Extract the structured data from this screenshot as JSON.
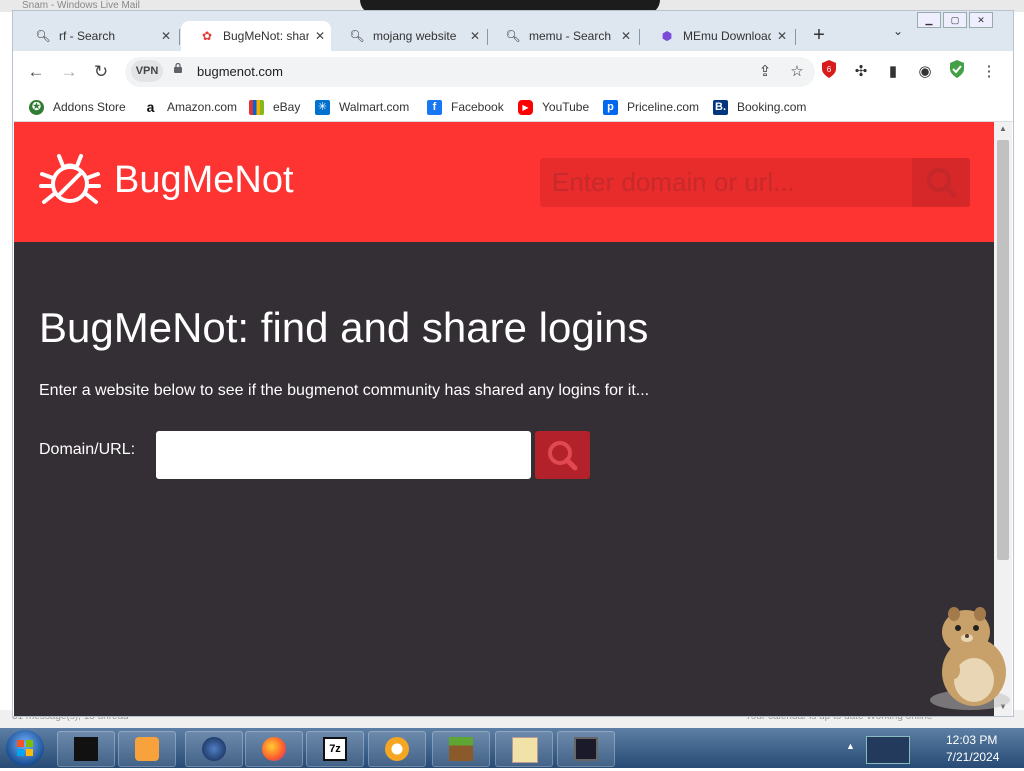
{
  "background": {
    "top_window_title": "Snam - Windows Live Mail",
    "bottom_left_status": "31 message(s), 15 unread",
    "bottom_right_status": "Your calendar is up to date   Working online"
  },
  "tabs": [
    {
      "label": "rf - Search",
      "icon": "search-icon",
      "active": false
    },
    {
      "label": "BugMeNot: share logins",
      "icon": "bug-icon",
      "active": true
    },
    {
      "label": "mojang website",
      "icon": "search-icon",
      "active": false
    },
    {
      "label": "memu - Search",
      "icon": "search-icon",
      "active": false
    },
    {
      "label": "MEmu Download",
      "icon": "memu-icon",
      "active": false
    }
  ],
  "toolbar": {
    "vpn_label": "VPN",
    "url": "bugmenot.com"
  },
  "bookmarks": [
    {
      "label": "Addons Store",
      "icon": "addons-icon",
      "color": "#2e7d32"
    },
    {
      "label": "Amazon.com",
      "icon": "amazon-icon",
      "color": "#111111"
    },
    {
      "label": "eBay",
      "icon": "ebay-icon",
      "color": "#e53238"
    },
    {
      "label": "Walmart.com",
      "icon": "walmart-icon",
      "color": "#0071ce"
    },
    {
      "label": "Facebook",
      "icon": "facebook-icon",
      "color": "#1877f2"
    },
    {
      "label": "YouTube",
      "icon": "youtube-icon",
      "color": "#ff0000"
    },
    {
      "label": "Priceline.com",
      "icon": "priceline-icon",
      "color": "#0068ef"
    },
    {
      "label": "Booking.com",
      "icon": "booking-icon",
      "color": "#003580"
    }
  ],
  "page": {
    "brand": "BugMeNot",
    "header_search_placeholder": "Enter domain or url...",
    "title": "BugMeNot: find and share logins",
    "description": "Enter a website below to see if the bugmenot community has shared any logins for it...",
    "domain_label": "Domain/URL:",
    "domain_value": "",
    "colors": {
      "hero": "#fe3433",
      "body": "#342e35",
      "button": "#b3222a"
    }
  },
  "taskbar": {
    "apps": [
      "black-window-icon",
      "media-player-icon",
      "globe-icon",
      "firefox-icon",
      "7zip-icon",
      "vpn-shield-icon",
      "minecraft-icon",
      "mail-icon",
      "monitor-icon"
    ],
    "time": "12:03 PM",
    "date": "7/21/2024"
  }
}
